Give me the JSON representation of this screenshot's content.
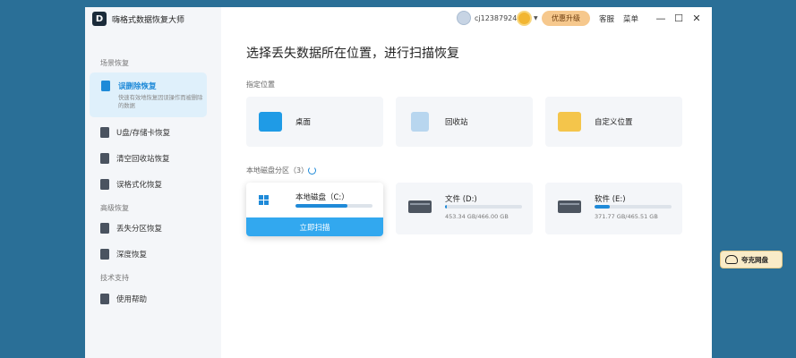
{
  "app": {
    "title": "嗨格式数据恢复大师",
    "logo_letter": "D"
  },
  "header": {
    "username": "cj12387924",
    "upgrade_label": "优惠升级",
    "service_label": "客服",
    "menu_label": "菜单",
    "minimize": "—",
    "maximize": "☐",
    "close": "✕"
  },
  "sidebar": {
    "section_scenes": "场景恢复",
    "active_item": {
      "label": "误删除恢复",
      "desc": "快速有效地恢复因误操作而被删除的数据"
    },
    "items_scenes": [
      {
        "label": "U盘/存储卡恢复"
      },
      {
        "label": "清空回收站恢复"
      },
      {
        "label": "误格式化恢复"
      }
    ],
    "section_advanced": "高级恢复",
    "items_advanced": [
      {
        "label": "丢失分区恢复"
      },
      {
        "label": "深度恢复"
      }
    ],
    "section_support": "技术支持",
    "items_support": [
      {
        "label": "使用帮助"
      }
    ]
  },
  "main": {
    "title": "选择丢失数据所在位置，进行扫描恢复",
    "locations_label": "指定位置",
    "locations": [
      {
        "label": "桌面",
        "icon": "desktop-icon"
      },
      {
        "label": "回收站",
        "icon": "recycle-bin-icon"
      },
      {
        "label": "自定义位置",
        "icon": "folder-icon"
      }
    ],
    "disks_label": "本地磁盘分区（3）",
    "disks": [
      {
        "name": "本地磁盘（C:）",
        "size": "",
        "used_fraction": 0.67,
        "scan_label": "立即扫描"
      },
      {
        "name": "文件 (D:)",
        "size": "453.34 GB/466.00 GB",
        "used_fraction": 0.02
      },
      {
        "name": "软件 (E:)",
        "size": "371.77 GB/465.51 GB",
        "used_fraction": 0.2
      }
    ]
  },
  "cloud_widget": {
    "label": "夸克网盘"
  },
  "colors": {
    "accent": "#1f8ad8",
    "scan_button": "#32a8ef",
    "background": "#2a6f97"
  }
}
